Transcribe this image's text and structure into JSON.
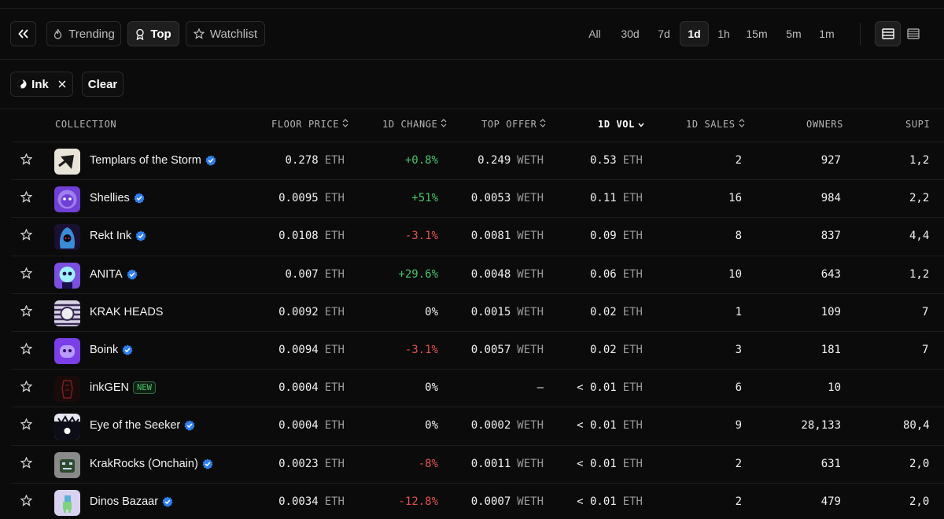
{
  "nav": {
    "tabs": [
      {
        "label": "Trending",
        "icon": "flame-icon"
      },
      {
        "label": "Top",
        "icon": "award-icon"
      },
      {
        "label": "Watchlist",
        "icon": "star-icon"
      }
    ],
    "active_tab": "Top",
    "timeframes": [
      "All",
      "30d",
      "7d",
      "1d",
      "1h",
      "15m",
      "5m",
      "1m"
    ],
    "active_timeframe": "1d"
  },
  "filters": {
    "chain_chip": "Ink",
    "clear_label": "Clear"
  },
  "table": {
    "columns": [
      "COLLECTION",
      "FLOOR PRICE",
      "1D CHANGE",
      "TOP OFFER",
      "1D VOL",
      "1D SALES",
      "OWNERS",
      "SUPI"
    ],
    "sorted_column": "1D VOL",
    "rows": [
      {
        "name": "Templars of the Storm",
        "verified": true,
        "floor": "0.278",
        "floor_unit": "ETH",
        "change": "+0.8%",
        "change_dir": "pos",
        "offer": "0.249",
        "offer_unit": "WETH",
        "vol": "0.53",
        "vol_unit": "ETH",
        "sales": "2",
        "owners": "927",
        "supply": "1,2"
      },
      {
        "name": "Shellies",
        "verified": true,
        "floor": "0.0095",
        "floor_unit": "ETH",
        "change": "+51%",
        "change_dir": "pos",
        "offer": "0.0053",
        "offer_unit": "WETH",
        "vol": "0.11",
        "vol_unit": "ETH",
        "sales": "16",
        "owners": "984",
        "supply": "2,2"
      },
      {
        "name": "Rekt Ink",
        "verified": true,
        "floor": "0.0108",
        "floor_unit": "ETH",
        "change": "-3.1%",
        "change_dir": "neg",
        "offer": "0.0081",
        "offer_unit": "WETH",
        "vol": "0.09",
        "vol_unit": "ETH",
        "sales": "8",
        "owners": "837",
        "supply": "4,4"
      },
      {
        "name": "ANITA",
        "verified": true,
        "floor": "0.007",
        "floor_unit": "ETH",
        "change": "+29.6%",
        "change_dir": "pos",
        "offer": "0.0048",
        "offer_unit": "WETH",
        "vol": "0.06",
        "vol_unit": "ETH",
        "sales": "10",
        "owners": "643",
        "supply": "1,2"
      },
      {
        "name": "KRAK HEADS",
        "verified": false,
        "floor": "0.0092",
        "floor_unit": "ETH",
        "change": "0%",
        "change_dir": "neutral",
        "offer": "0.0015",
        "offer_unit": "WETH",
        "vol": "0.02",
        "vol_unit": "ETH",
        "sales": "1",
        "owners": "109",
        "supply": "7"
      },
      {
        "name": "Boink",
        "verified": true,
        "floor": "0.0094",
        "floor_unit": "ETH",
        "change": "-3.1%",
        "change_dir": "neg",
        "offer": "0.0057",
        "offer_unit": "WETH",
        "vol": "0.02",
        "vol_unit": "ETH",
        "sales": "3",
        "owners": "181",
        "supply": "7"
      },
      {
        "name": "inkGEN",
        "verified": false,
        "is_new": true,
        "new_label": "NEW",
        "floor": "0.0004",
        "floor_unit": "ETH",
        "change": "0%",
        "change_dir": "neutral",
        "offer": "–",
        "offer_unit": "",
        "vol": "< 0.01",
        "vol_unit": "ETH",
        "sales": "6",
        "owners": "10",
        "supply": ""
      },
      {
        "name": "Eye of the Seeker",
        "verified": true,
        "floor": "0.0004",
        "floor_unit": "ETH",
        "change": "0%",
        "change_dir": "neutral",
        "offer": "0.0002",
        "offer_unit": "WETH",
        "vol": "< 0.01",
        "vol_unit": "ETH",
        "sales": "9",
        "owners": "28,133",
        "supply": "80,4"
      },
      {
        "name": "KrakRocks (Onchain)",
        "verified": true,
        "floor": "0.0023",
        "floor_unit": "ETH",
        "change": "-8%",
        "change_dir": "neg",
        "offer": "0.0011",
        "offer_unit": "WETH",
        "vol": "< 0.01",
        "vol_unit": "ETH",
        "sales": "2",
        "owners": "631",
        "supply": "2,0"
      },
      {
        "name": "Dinos Bazaar",
        "verified": true,
        "floor": "0.0034",
        "floor_unit": "ETH",
        "change": "-12.8%",
        "change_dir": "neg",
        "offer": "0.0007",
        "offer_unit": "WETH",
        "vol": "< 0.01",
        "vol_unit": "ETH",
        "sales": "2",
        "owners": "479",
        "supply": "2,0"
      }
    ]
  },
  "colors": {
    "background": "#0b0b0b",
    "positive": "#4bc46b",
    "negative": "#e05252",
    "verified": "#2f80ed"
  }
}
